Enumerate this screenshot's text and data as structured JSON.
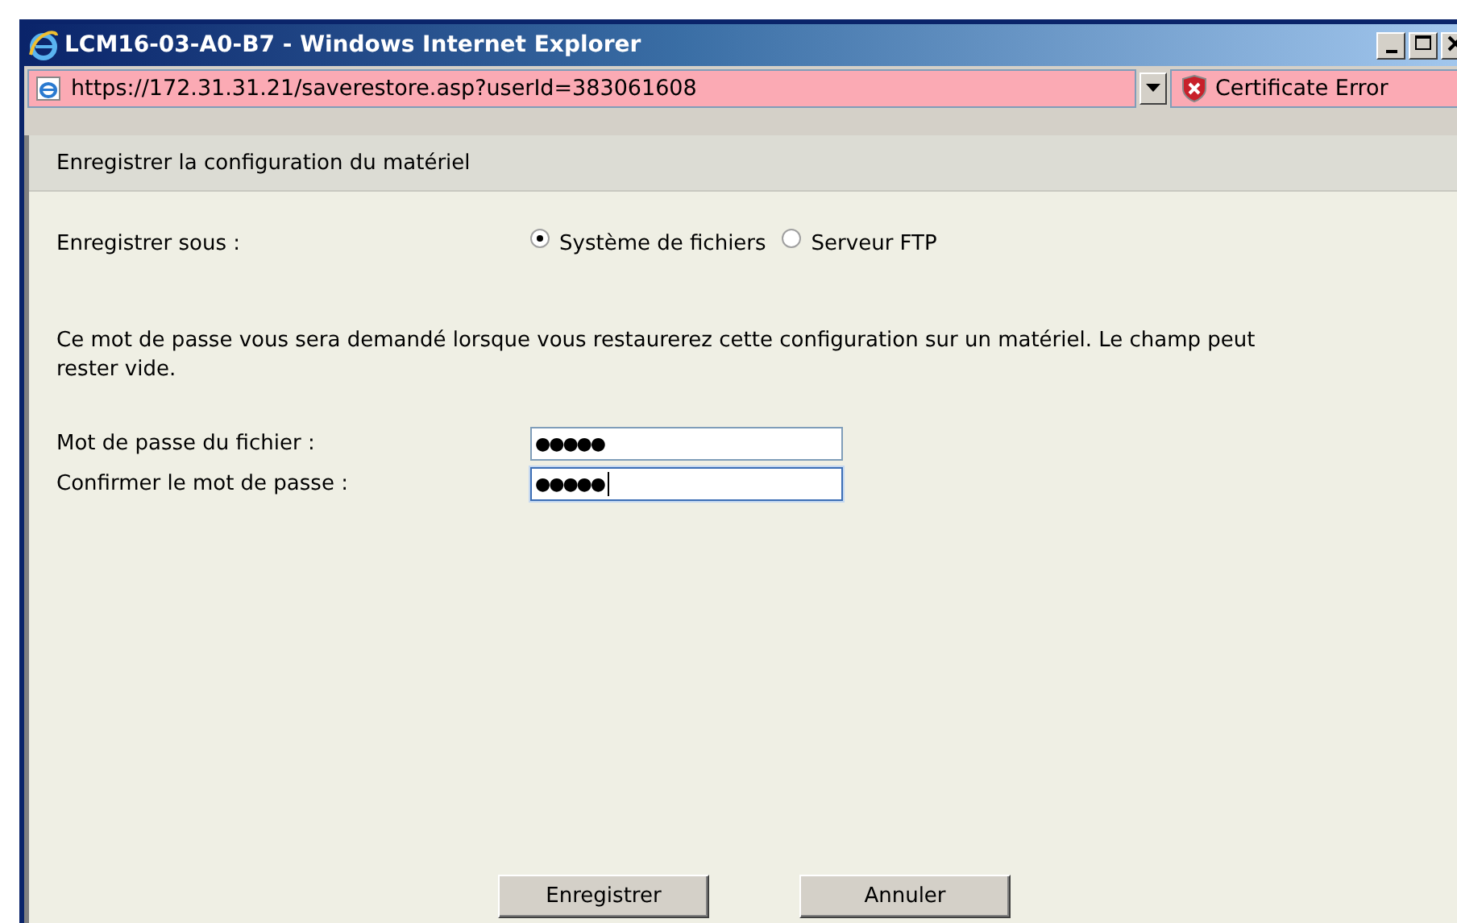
{
  "window": {
    "title": "LCM16-03-A0-B7 - Windows Internet Explorer"
  },
  "address_bar": {
    "url": "https://172.31.31.21/saverestore.asp?userId=383061608",
    "certificate_status": "Certificate Error"
  },
  "page": {
    "heading": "Enregistrer la configuration du matériel",
    "save_as": {
      "label": "Enregistrer sous :",
      "options": [
        {
          "label": "Système de fichiers",
          "selected": true
        },
        {
          "label": "Serveur FTP",
          "selected": false
        }
      ]
    },
    "note": "Ce mot de passe vous sera demandé lorsque vous restaurerez cette configuration sur un matériel. Le champ peut rester vide.",
    "fields": [
      {
        "label": "Mot de passe du fichier :",
        "value": "●●●●●",
        "focused": false
      },
      {
        "label": "Confirmer le mot de passe :",
        "value": "●●●●●",
        "focused": true
      }
    ],
    "buttons": [
      "Enregistrer",
      "Annuler"
    ]
  }
}
